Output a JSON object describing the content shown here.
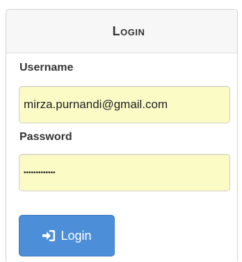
{
  "login": {
    "title": "Login",
    "username_label": "Username",
    "username_value": "mirza.purnandi@gmail.com",
    "password_label": "Password",
    "password_value": "•••••••••••••",
    "submit_label": "Login",
    "submit_icon": "sign-in-icon"
  },
  "colors": {
    "button": "#4c8fd8",
    "input_autofill": "#fbfbc6",
    "heading_bg": "#f7f7f7"
  }
}
